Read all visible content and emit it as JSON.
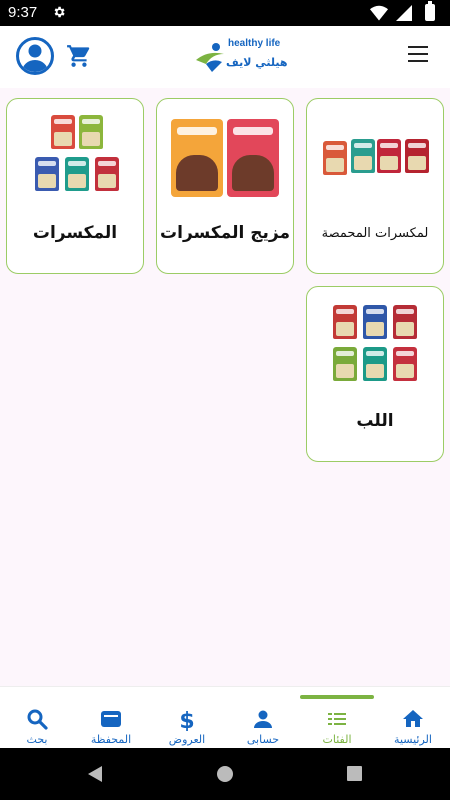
{
  "status_bar": {
    "time": "9:37"
  },
  "header": {
    "logo_en": "healthy life",
    "logo_ar": "هيلثي لايف"
  },
  "categories": [
    {
      "title": "لمكسرات المحمصة"
    },
    {
      "title": "مزيج المكسرات"
    },
    {
      "title": "المكسرات"
    },
    {
      "title": "اللب"
    }
  ],
  "bottom_nav": {
    "items": [
      {
        "label": "الرئيسية",
        "icon": "home-icon"
      },
      {
        "label": "الفئات",
        "icon": "categories-icon"
      },
      {
        "label": "حسابى",
        "icon": "account-icon"
      },
      {
        "label": "العروض",
        "icon": "dollar-icon"
      },
      {
        "label": "المحفظة",
        "icon": "wallet-icon"
      },
      {
        "label": "بحث",
        "icon": "search-icon"
      }
    ],
    "active": "الفئات"
  },
  "colors": {
    "primary": "#1565c0",
    "accent": "#7cb342",
    "card_border": "#9ccc65",
    "background": "#fdf6fc"
  }
}
